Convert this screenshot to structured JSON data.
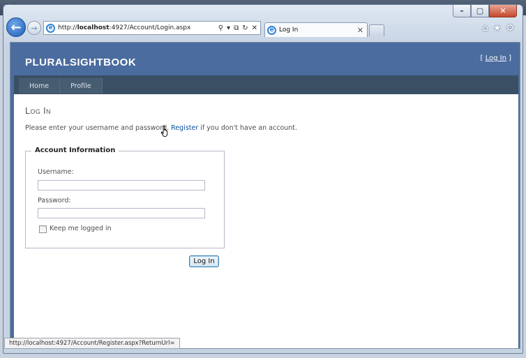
{
  "browser": {
    "address_url_prefix": "http://",
    "address_url_host": "localhost",
    "address_url_rest": ":4927/Account/Login.aspx",
    "tab_title": "Log In",
    "status_url": "http://localhost:4927/Account/Register.aspx?ReturnUrl="
  },
  "site": {
    "title": "PLURALSIGHTBOOK",
    "login_prefix": "[ ",
    "login_link": "Log In",
    "login_suffix": " ]"
  },
  "menu": {
    "items": [
      {
        "label": "Home"
      },
      {
        "label": "Profile"
      }
    ]
  },
  "main": {
    "title": "Log In",
    "intro_before": "Please enter your username and password. ",
    "register_link": "Register",
    "intro_after": " if you don't have an account.",
    "fieldset_legend": "Account Information",
    "username_label": "Username:",
    "username_value": "",
    "password_label": "Password:",
    "password_value": "",
    "remember_label": "Keep me logged in",
    "remember_checked": false,
    "submit_label": "Log In"
  },
  "colors": {
    "header": "#4b6c9e",
    "menu_bar": "#3a4f63",
    "link": "#0b4fa0"
  }
}
